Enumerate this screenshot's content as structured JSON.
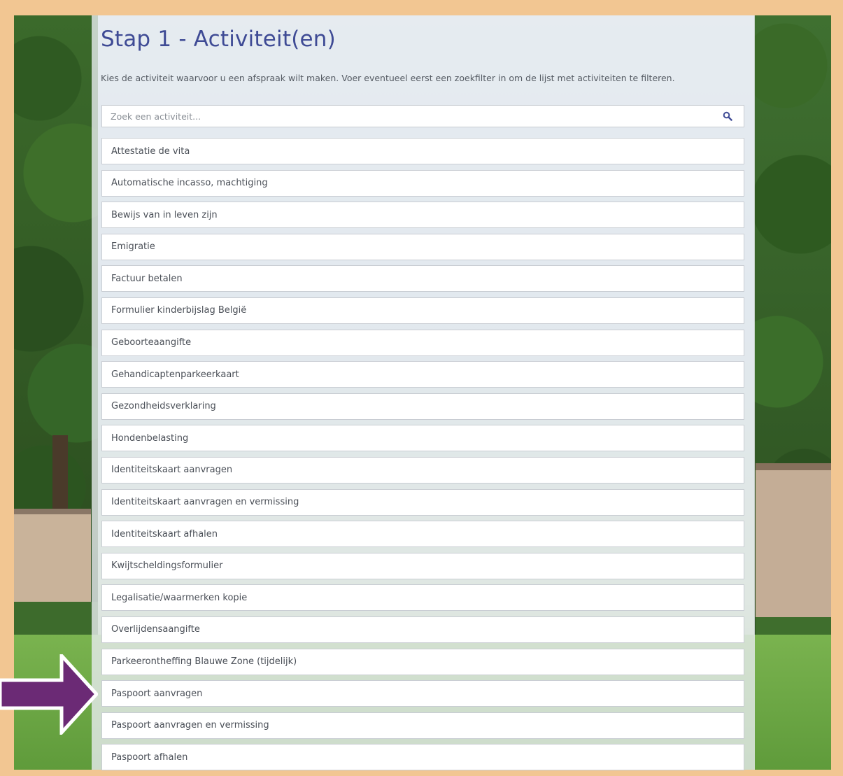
{
  "page": {
    "title": "Stap 1 - Activiteit(en)",
    "instructions": "Kies de activiteit waarvoor u een afspraak wilt maken. Voer eventueel eerst een zoekfilter in om de lijst met activiteiten te filteren."
  },
  "search": {
    "placeholder": "Zoek een activiteit...",
    "value": "",
    "icon": "search-icon"
  },
  "activities": [
    "Attestatie de vita",
    "Automatische incasso, machtiging",
    "Bewijs van in leven zijn",
    "Emigratie",
    "Factuur betalen",
    "Formulier kinderbijslag België",
    "Geboorteaangifte",
    "Gehandicaptenparkeerkaart",
    "Gezondheidsverklaring",
    "Hondenbelasting",
    "Identiteitskaart aanvragen",
    "Identiteitskaart aanvragen en vermissing",
    "Identiteitskaart afhalen",
    "Kwijtscheldingsformulier",
    "Legalisatie/waarmerken kopie",
    "Overlijdensaangifte",
    "Parkeerontheffing Blauwe Zone (tijdelijk)",
    "Paspoort aanvragen",
    "Paspoort aanvragen en vermissing",
    "Paspoort afhalen"
  ],
  "colors": {
    "frame": "#f2c692",
    "title": "#3f4b95",
    "arrow": "#6b2a75"
  }
}
